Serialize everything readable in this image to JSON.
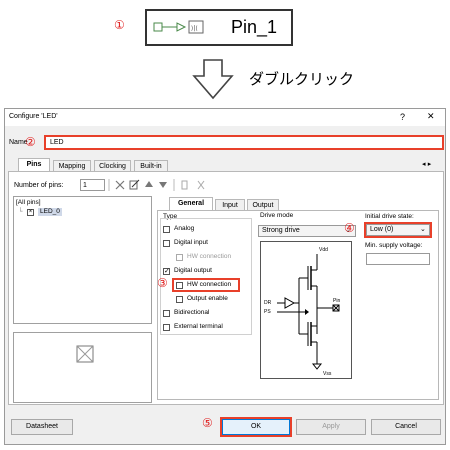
{
  "steps": {
    "one": "①",
    "two": "②",
    "three": "③",
    "four": "④",
    "five": "⑤"
  },
  "component": {
    "label": "Pin_1"
  },
  "double_click": "ダブルクリック",
  "dialog": {
    "title": "Configure 'LED'",
    "help": "?",
    "close": "✕",
    "name_label": "Name",
    "name_value": "LED",
    "tabs": [
      "Pins",
      "Mapping",
      "Clocking",
      "Built-in"
    ],
    "tab_arrows": "◂ ▸",
    "num_pins_label": "Number of pins:",
    "num_pins_value": "1",
    "tree_root": "[All pins]",
    "tree_child": "LED_0",
    "subtabs": [
      "General",
      "Input",
      "Output"
    ],
    "type_label": "Type",
    "types": [
      {
        "label": "Analog",
        "checked": false,
        "disabled": false
      },
      {
        "label": "Digital input",
        "checked": false,
        "disabled": false
      },
      {
        "label": "HW connection",
        "checked": false,
        "disabled": true
      },
      {
        "label": "Digital output",
        "checked": true,
        "disabled": false
      },
      {
        "label": "HW connection",
        "checked": false,
        "disabled": false
      },
      {
        "label": "Output enable",
        "checked": false,
        "disabled": false
      },
      {
        "label": "Bidirectional",
        "checked": false,
        "disabled": false
      },
      {
        "label": "External terminal",
        "checked": false,
        "disabled": false
      }
    ],
    "drive_mode_label": "Drive mode",
    "drive_mode_value": "Strong drive",
    "initial_state_label": "Initial drive state:",
    "initial_state_value": "Low (0)",
    "min_supply_label": "Min. supply voltage:",
    "min_supply_value": "",
    "schematic": {
      "vdd": "Vdd",
      "dr": "DR",
      "ps": "PS",
      "pin": "Pin",
      "vss": "Vss"
    },
    "buttons": {
      "datasheet": "Datasheet",
      "ok": "OK",
      "apply": "Apply",
      "cancel": "Cancel"
    }
  },
  "colors": {
    "highlight": "#e8402a",
    "tab_blue": "#1a6fd0"
  }
}
